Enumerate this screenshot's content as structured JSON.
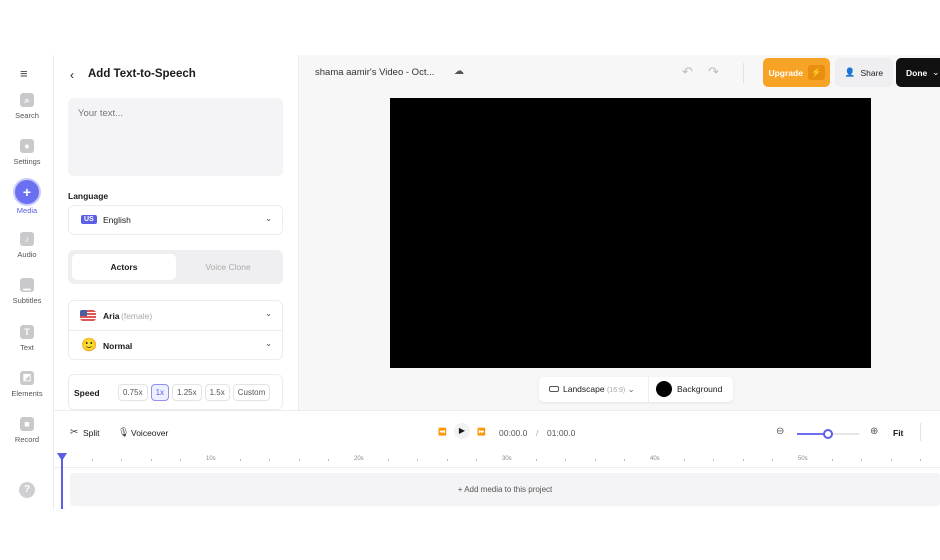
{
  "sidebar": {
    "items": [
      {
        "label": "Search",
        "icon": "search-icon"
      },
      {
        "label": "Settings",
        "icon": "gear-icon"
      },
      {
        "label": "Media",
        "icon": "plus-icon",
        "active": true
      },
      {
        "label": "Audio",
        "icon": "music-note-icon"
      },
      {
        "label": "Subtitles",
        "icon": "subtitles-icon"
      },
      {
        "label": "Text",
        "icon": "text-icon"
      },
      {
        "label": "Elements",
        "icon": "elements-icon"
      },
      {
        "label": "Record",
        "icon": "camera-icon"
      }
    ],
    "help_icon": "?"
  },
  "panel": {
    "title": "Add Text-to-Speech",
    "text_placeholder": "Your text...",
    "language_label": "Language",
    "language_badge": "US",
    "language_value": "English",
    "tabs": [
      "Actors",
      "Voice Clone"
    ],
    "active_tab": "Actors",
    "voice_name": "Aria",
    "voice_gender": "(female)",
    "style": "Normal",
    "speed_label": "Speed",
    "speeds": [
      "0.75x",
      "1x",
      "1.25x",
      "1.5x",
      "Custom"
    ],
    "selected_speed": "1x"
  },
  "header": {
    "project_title": "shama aamir's Video - Oct...",
    "upgrade": "Upgrade",
    "share": "Share",
    "done": "Done"
  },
  "canvas": {
    "aspect_label": "Landscape",
    "aspect_ratio": "(16:9)",
    "background_label": "Background",
    "background_color": "#000000"
  },
  "timeline": {
    "split": "Split",
    "voiceover": "Voiceover",
    "current_time": "00:00.0",
    "separator": "/",
    "duration": "01:00.0",
    "fit": "Fit",
    "zoom_level": 0.5,
    "ruler_labels": [
      "10s",
      "20s",
      "30s",
      "40s",
      "50s"
    ],
    "add_media": "Add media to this project"
  },
  "colors": {
    "accent": "#6b70f2",
    "upgrade": "#f7a325",
    "done": "#111111"
  }
}
